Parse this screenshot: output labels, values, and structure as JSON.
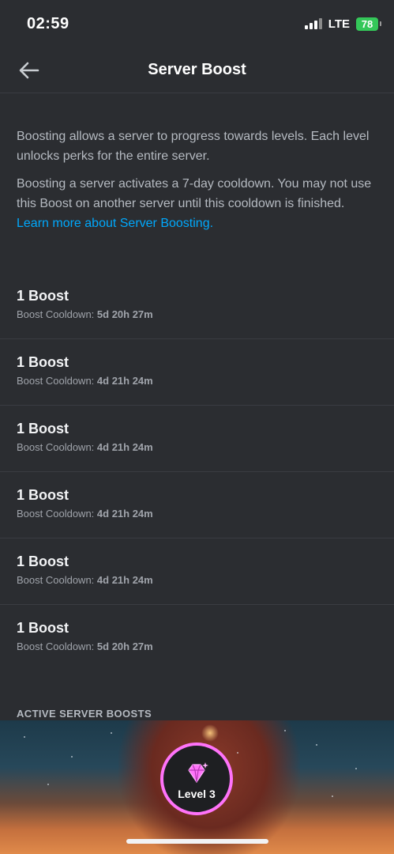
{
  "status_bar": {
    "time": "02:59",
    "network": "LTE",
    "battery": "78"
  },
  "header": {
    "title": "Server Boost",
    "back_icon": "arrow-left-icon"
  },
  "description": {
    "paragraph1": "Boosting allows a server to progress towards levels. Each level unlocks perks for the entire server.",
    "paragraph2": "Boosting a server activates a 7-day cooldown. You may not use this Boost on another server until this cooldown is finished.",
    "link": "Learn more about Server Boosting."
  },
  "boosts": [
    {
      "title": "1 Boost",
      "cooldown_label": "Boost Cooldown:",
      "cooldown": "5d 20h 27m"
    },
    {
      "title": "1 Boost",
      "cooldown_label": "Boost Cooldown:",
      "cooldown": "4d 21h 24m"
    },
    {
      "title": "1 Boost",
      "cooldown_label": "Boost Cooldown:",
      "cooldown": "4d 21h 24m"
    },
    {
      "title": "1 Boost",
      "cooldown_label": "Boost Cooldown:",
      "cooldown": "4d 21h 24m"
    },
    {
      "title": "1 Boost",
      "cooldown_label": "Boost Cooldown:",
      "cooldown": "4d 21h 24m"
    },
    {
      "title": "1 Boost",
      "cooldown_label": "Boost Cooldown:",
      "cooldown": "5d 20h 27m"
    }
  ],
  "active_section": {
    "header": "ACTIVE SERVER BOOSTS",
    "level": "Level 3",
    "level_icon": "boost-gem-icon"
  },
  "colors": {
    "background": "#2b2d31",
    "link": "#00a8fc",
    "badge_border": "#ff73fa",
    "battery": "#34c759"
  }
}
